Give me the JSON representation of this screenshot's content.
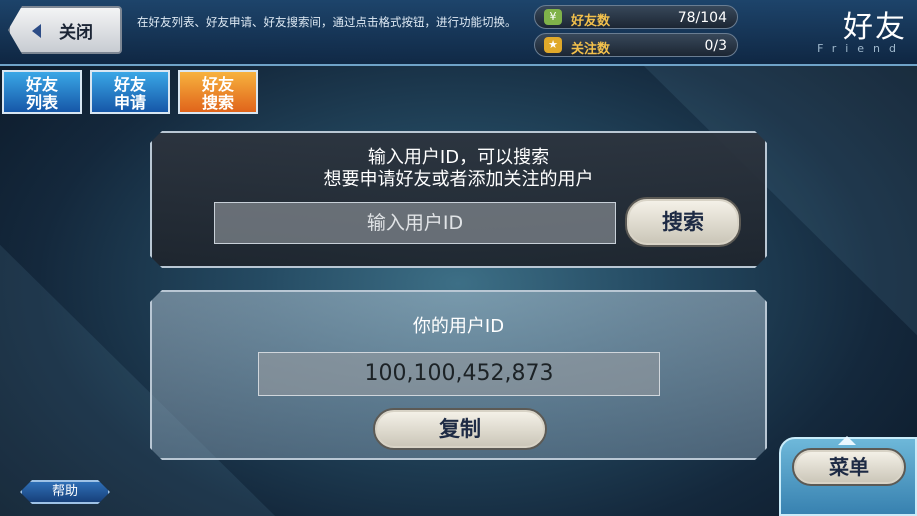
{
  "header": {
    "close_label": "关闭",
    "hint": "在好友列表、好友申请、好友搜索间，通过点击格式按钮，进行功能切换。",
    "title": "好友",
    "subtitle": "Friend"
  },
  "stats": [
    {
      "label": "好友数",
      "value": "78/104",
      "icon": "friend-count-icon"
    },
    {
      "label": "关注数",
      "value": "0/3",
      "icon": "follow-count-icon"
    }
  ],
  "tabs": [
    {
      "line1": "好友",
      "line2": "列表",
      "active": false
    },
    {
      "line1": "好友",
      "line2": "申请",
      "active": false
    },
    {
      "line1": "好友",
      "line2": "搜索",
      "active": true
    }
  ],
  "search": {
    "message_line1": "输入用户ID，可以搜索",
    "message_line2": "想要申请好友或者添加关注的用户",
    "placeholder": "输入用户ID",
    "button_label": "搜索"
  },
  "my_id": {
    "title": "你的用户ID",
    "value": "100,100,452,873",
    "copy_label": "复制"
  },
  "footer": {
    "help_label": "帮助",
    "menu_label": "菜单"
  },
  "colors": {
    "active_tab": "#e0641b",
    "inactive_tab": "#1657a8",
    "stat_label": "#f2c04c"
  }
}
